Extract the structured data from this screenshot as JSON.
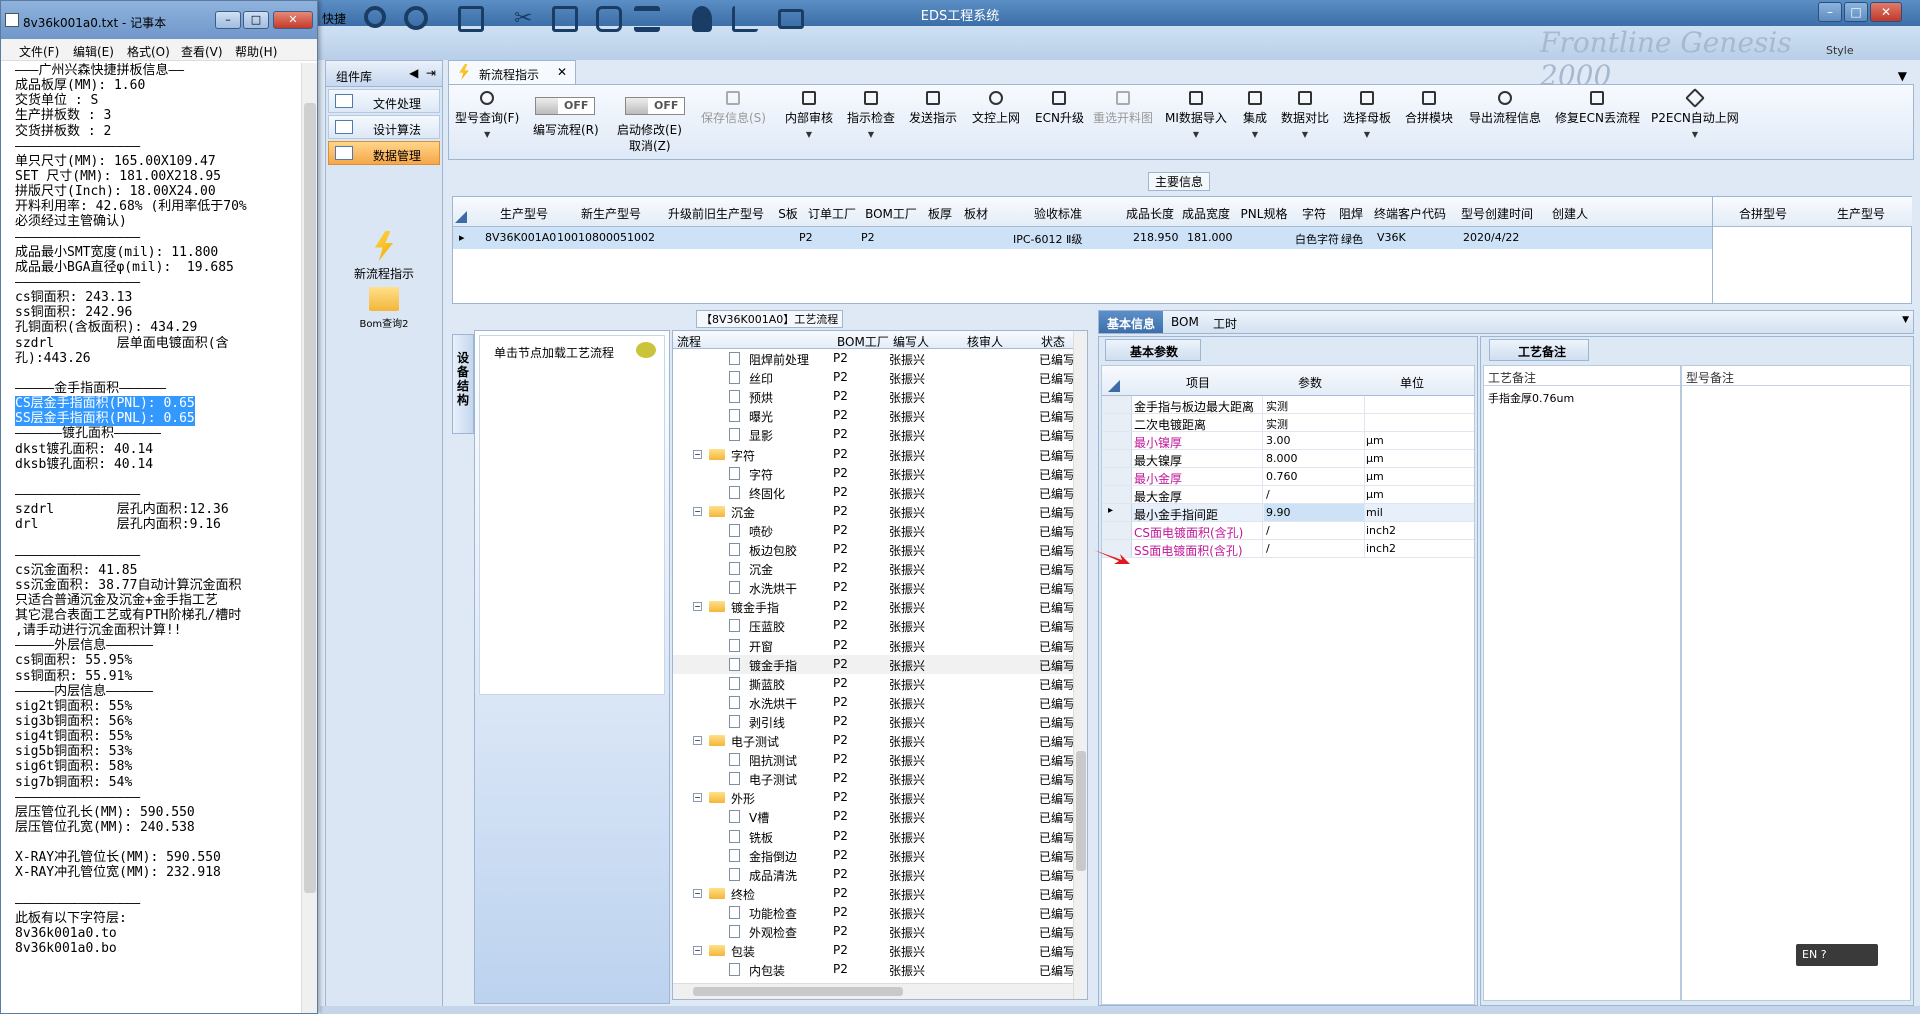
{
  "eds": {
    "title": "EDS工程系统",
    "style_label": "Style",
    "banner_text": "Frontline Genesis 2000",
    "toolbar_fragment": "快捷",
    "component_library": {
      "title": "组件库",
      "items": [
        {
          "label": "文件处理"
        },
        {
          "label": "设计算法"
        },
        {
          "label": "数据管理"
        }
      ],
      "tools": [
        {
          "label": "新流程指示"
        },
        {
          "label": "Bom查询2"
        }
      ]
    },
    "tab": {
      "label": "新流程指示"
    },
    "commands": [
      {
        "label": "型号查询(F)",
        "disabled": false,
        "dropdown": true
      },
      {
        "label": "编写流程(R)",
        "toggle": "OFF"
      },
      {
        "label": "启动修改(E)",
        "label2": "取消(Z)",
        "toggle": "OFF"
      },
      {
        "label": "保存信息(S)",
        "disabled": true
      },
      {
        "label": "内部审核",
        "dropdown": true
      },
      {
        "label": "指示检查",
        "dropdown": true
      },
      {
        "label": "发送指示"
      },
      {
        "label": "文控上网"
      },
      {
        "label": "ECN升级"
      },
      {
        "label": "重选开料图",
        "disabled": true
      },
      {
        "label": "MI数据导入",
        "dropdown": true
      },
      {
        "label": "集成",
        "dropdown": true
      },
      {
        "label": "数据对比",
        "dropdown": true
      },
      {
        "label": "选择母板",
        "dropdown": true
      },
      {
        "label": "合拼模块"
      },
      {
        "label": "导出流程信息"
      },
      {
        "label": "修复ECN丢流程"
      },
      {
        "label": "P2ECN自动上网",
        "dropdown": true
      }
    ],
    "main_info": {
      "label": "主要信息",
      "columns": [
        "生产型号",
        "新生产型号",
        "升级前旧生产型号",
        "S板",
        "订单工厂",
        "BOM工厂",
        "板厚",
        "板材",
        "验收标准",
        "成品长度",
        "成品宽度",
        "PNL规格",
        "字符",
        "阻焊",
        "终端客户代码",
        "型号创建时间",
        "创建人"
      ],
      "row": [
        "8V36K001A0",
        "10010800051002",
        "",
        "",
        "P2",
        "P2",
        "",
        "",
        "IPC-6012 Ⅱ级",
        "218.950",
        "181.000",
        "",
        "白色字符",
        "绿色",
        "V36K",
        "2020/4/22",
        ""
      ],
      "side_columns": [
        "合拼型号",
        "生产型号"
      ]
    },
    "process": {
      "label": "【8V36K001A0】工艺流程",
      "side_tab": "设备结构",
      "hint": "单击节点加载工艺流程",
      "columns": [
        "流程",
        "BOM工厂",
        "编写人",
        "核审人",
        "状态"
      ],
      "rows": [
        {
          "name": "阻焊前处理",
          "level": 2,
          "factory": "P2",
          "writer": "张振兴",
          "status": "已编写"
        },
        {
          "name": "丝印",
          "level": 2,
          "factory": "P2",
          "writer": "张振兴",
          "status": "已编写"
        },
        {
          "name": "预烘",
          "level": 2,
          "factory": "P2",
          "writer": "张振兴",
          "status": "已编写"
        },
        {
          "name": "曝光",
          "level": 2,
          "factory": "P2",
          "writer": "张振兴",
          "status": "已编写"
        },
        {
          "name": "显影",
          "level": 2,
          "factory": "P2",
          "writer": "张振兴",
          "status": "已编写"
        },
        {
          "name": "字符",
          "level": 1,
          "factory": "P2",
          "writer": "张振兴",
          "status": "已编写"
        },
        {
          "name": "字符",
          "level": 2,
          "factory": "P2",
          "writer": "张振兴",
          "status": "已编写"
        },
        {
          "name": "终固化",
          "level": 2,
          "factory": "P2",
          "writer": "张振兴",
          "status": "已编写"
        },
        {
          "name": "沉金",
          "level": 1,
          "factory": "P2",
          "writer": "张振兴",
          "status": "已编写"
        },
        {
          "name": "喷砂",
          "level": 2,
          "factory": "P2",
          "writer": "张振兴",
          "status": "已编写"
        },
        {
          "name": "板边包胶",
          "level": 2,
          "factory": "P2",
          "writer": "张振兴",
          "status": "已编写"
        },
        {
          "name": "沉金",
          "level": 2,
          "factory": "P2",
          "writer": "张振兴",
          "status": "已编写"
        },
        {
          "name": "水洗烘干",
          "level": 2,
          "factory": "P2",
          "writer": "张振兴",
          "status": "已编写"
        },
        {
          "name": "镀金手指",
          "level": 1,
          "factory": "P2",
          "writer": "张振兴",
          "status": "已编写"
        },
        {
          "name": "压蓝胶",
          "level": 2,
          "factory": "P2",
          "writer": "张振兴",
          "status": "已编写"
        },
        {
          "name": "开窗",
          "level": 2,
          "factory": "P2",
          "writer": "张振兴",
          "status": "已编写"
        },
        {
          "name": "镀金手指",
          "level": 2,
          "factory": "P2",
          "writer": "张振兴",
          "status": "已编写",
          "selected": true
        },
        {
          "name": "撕蓝胶",
          "level": 2,
          "factory": "P2",
          "writer": "张振兴",
          "status": "已编写"
        },
        {
          "name": "水洗烘干",
          "level": 2,
          "factory": "P2",
          "writer": "张振兴",
          "status": "已编写"
        },
        {
          "name": "剥引线",
          "level": 2,
          "factory": "P2",
          "writer": "张振兴",
          "status": "已编写"
        },
        {
          "name": "电子测试",
          "level": 1,
          "factory": "P2",
          "writer": "张振兴",
          "status": "已编写"
        },
        {
          "name": "阻抗测试",
          "level": 2,
          "factory": "P2",
          "writer": "张振兴",
          "status": "已编写"
        },
        {
          "name": "电子测试",
          "level": 2,
          "factory": "P2",
          "writer": "张振兴",
          "status": "已编写"
        },
        {
          "name": "外形",
          "level": 1,
          "factory": "P2",
          "writer": "张振兴",
          "status": "已编写"
        },
        {
          "name": "V槽",
          "level": 2,
          "factory": "P2",
          "writer": "张振兴",
          "status": "已编写"
        },
        {
          "name": "铣板",
          "level": 2,
          "factory": "P2",
          "writer": "张振兴",
          "status": "已编写"
        },
        {
          "name": "金指倒边",
          "level": 2,
          "factory": "P2",
          "writer": "张振兴",
          "status": "已编写"
        },
        {
          "name": "成品清洗",
          "level": 2,
          "factory": "P2",
          "writer": "张振兴",
          "status": "已编写"
        },
        {
          "name": "终检",
          "level": 1,
          "factory": "P2",
          "writer": "张振兴",
          "status": "已编写"
        },
        {
          "name": "功能检查",
          "level": 2,
          "factory": "P2",
          "writer": "张振兴",
          "status": "已编写"
        },
        {
          "name": "外观检查",
          "level": 2,
          "factory": "P2",
          "writer": "张振兴",
          "status": "已编写"
        },
        {
          "name": "包装",
          "level": 1,
          "factory": "P2",
          "writer": "张振兴",
          "status": "已编写"
        },
        {
          "name": "内包装",
          "level": 2,
          "factory": "P2",
          "writer": "张振兴",
          "status": "已编写"
        }
      ]
    },
    "info_tabs": [
      "基本信息",
      "BOM",
      "工时"
    ],
    "basic_params": {
      "subtab": "基本参数",
      "columns": [
        "项目",
        "参数",
        "单位"
      ],
      "rows": [
        {
          "item": "金手指与板边最大距离",
          "value": "实测",
          "unit": "",
          "magenta": false
        },
        {
          "item": "二次电镀距离",
          "value": "实测",
          "unit": "",
          "magenta": false
        },
        {
          "item": "最小镍厚",
          "value": "3.00",
          "unit": "μm",
          "magenta": true
        },
        {
          "item": "最大镍厚",
          "value": "8.000",
          "unit": "μm",
          "magenta": false
        },
        {
          "item": "最小金厚",
          "value": "0.760",
          "unit": "μm",
          "magenta": true
        },
        {
          "item": "最大金厚",
          "value": "/",
          "unit": "μm",
          "magenta": false
        },
        {
          "item": "最小金手指间距",
          "value": "9.90",
          "unit": "mil",
          "magenta": false,
          "current": true
        },
        {
          "item": "CS面电镀面积(含孔)",
          "value": "/",
          "unit": "inch2",
          "magenta": true
        },
        {
          "item": "SS面电镀面积(含孔)",
          "value": "/",
          "unit": "inch2",
          "magenta": true
        }
      ]
    },
    "remarks": {
      "subtab": "工艺备注",
      "col1_head": "工艺备注",
      "col1_text": "手指金厚0.76um",
      "col2_head": "型号备注"
    },
    "ime": "EN"
  },
  "notepad": {
    "title": "8v36k001a0.txt - 记事本",
    "menus": [
      "文件(F)",
      "编辑(E)",
      "格式(O)",
      "查看(V)",
      "帮助(H)"
    ],
    "lines": [
      {
        "t": "———广州兴森快捷拼板信息——"
      },
      {
        "t": "成品板厚(MM): 1.60"
      },
      {
        "t": "交货单位 : S"
      },
      {
        "t": "生产拼板数 : 3"
      },
      {
        "t": "交货拼板数 : 2"
      },
      {
        "t": "————————————————"
      },
      {
        "t": "单只尺寸(MM): 165.00X109.47"
      },
      {
        "t": "SET 尺寸(MM): 181.00X218.95"
      },
      {
        "t": "拼版尺寸(Inch): 18.00X24.00"
      },
      {
        "t": "开料利用率: 42.68% (利用率低于70%"
      },
      {
        "t": "必须经过主管确认)"
      },
      {
        "t": "————————————————"
      },
      {
        "t": "成品最小SMT宽度(mil): 11.800"
      },
      {
        "t": "成品最小BGA直径φ(mil):  19.685"
      },
      {
        "t": "————————————————"
      },
      {
        "t": "cs铜面积: 243.13"
      },
      {
        "t": "ss铜面积: 242.96"
      },
      {
        "t": "孔铜面积(含板面积): 434.29"
      },
      {
        "t": "szdrl        层单面电镀面积(含"
      },
      {
        "t": "孔):443.26"
      },
      {
        "t": ""
      },
      {
        "t": "—————金手指面积——————"
      },
      {
        "t": "CS层金手指面积(PNL): 0.65",
        "hl": true
      },
      {
        "t": "SS层金手指面积(PNL): 0.65",
        "hl": true
      },
      {
        "t": "——————镀孔面积——————"
      },
      {
        "t": "dkst镀孔面积: 40.14"
      },
      {
        "t": "dksb镀孔面积: 40.14"
      },
      {
        "t": ""
      },
      {
        "t": "————————————————"
      },
      {
        "t": "szdrl        层孔内面积:12.36"
      },
      {
        "t": "drl          层孔内面积:9.16"
      },
      {
        "t": ""
      },
      {
        "t": "————————————————"
      },
      {
        "t": "cs沉金面积: 41.85"
      },
      {
        "t": "ss沉金面积: 38.77自动计算沉金面积"
      },
      {
        "t": "只适合普通沉金及沉金+金手指工艺"
      },
      {
        "t": "其它混合表面工艺或有PTH阶梯孔/槽时"
      },
      {
        "t": ",请手动进行沉金面积计算!!"
      },
      {
        "t": "—————外层信息——————"
      },
      {
        "t": "cs铜面积: 55.95%"
      },
      {
        "t": "ss铜面积: 55.91%"
      },
      {
        "t": "—————内层信息——————"
      },
      {
        "t": "sig2t铜面积: 55%"
      },
      {
        "t": "sig3b铜面积: 56%"
      },
      {
        "t": "sig4t铜面积: 55%"
      },
      {
        "t": "sig5b铜面积: 53%"
      },
      {
        "t": "sig6t铜面积: 58%"
      },
      {
        "t": "sig7b铜面积: 54%"
      },
      {
        "t": "————————————————"
      },
      {
        "t": "层压管位孔长(MM): 590.550"
      },
      {
        "t": "层压管位孔宽(MM): 240.538"
      },
      {
        "t": ""
      },
      {
        "t": "X-RAY冲孔管位长(MM): 590.550"
      },
      {
        "t": "X-RAY冲孔管位宽(MM): 232.918"
      },
      {
        "t": ""
      },
      {
        "t": "————————————————"
      },
      {
        "t": "此板有以下字符层:"
      },
      {
        "t": "8v36k001a0.to"
      },
      {
        "t": "8v36k001a0.bo"
      }
    ]
  }
}
